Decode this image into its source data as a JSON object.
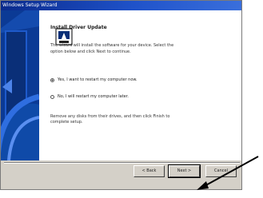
{
  "window": {
    "title": "Windows Setup Wizard"
  },
  "page": {
    "heading": "Install Driver Update",
    "description": "The wizard will install the software for your device. Select the option below and click Next to continue.",
    "options": [
      {
        "label": "Yes, I want to restart my computer now.",
        "selected": true
      },
      {
        "label": "No, I will restart my computer later.",
        "selected": false
      }
    ],
    "note": "Remove any disks from their drives, and then click Finish to complete setup."
  },
  "buttons": {
    "back": "< Back",
    "next": "Next >",
    "cancel": "Cancel"
  },
  "colors": {
    "titlebar": "#1f52c9",
    "banner": "#0b3a95",
    "face": "#d4d0c8"
  }
}
